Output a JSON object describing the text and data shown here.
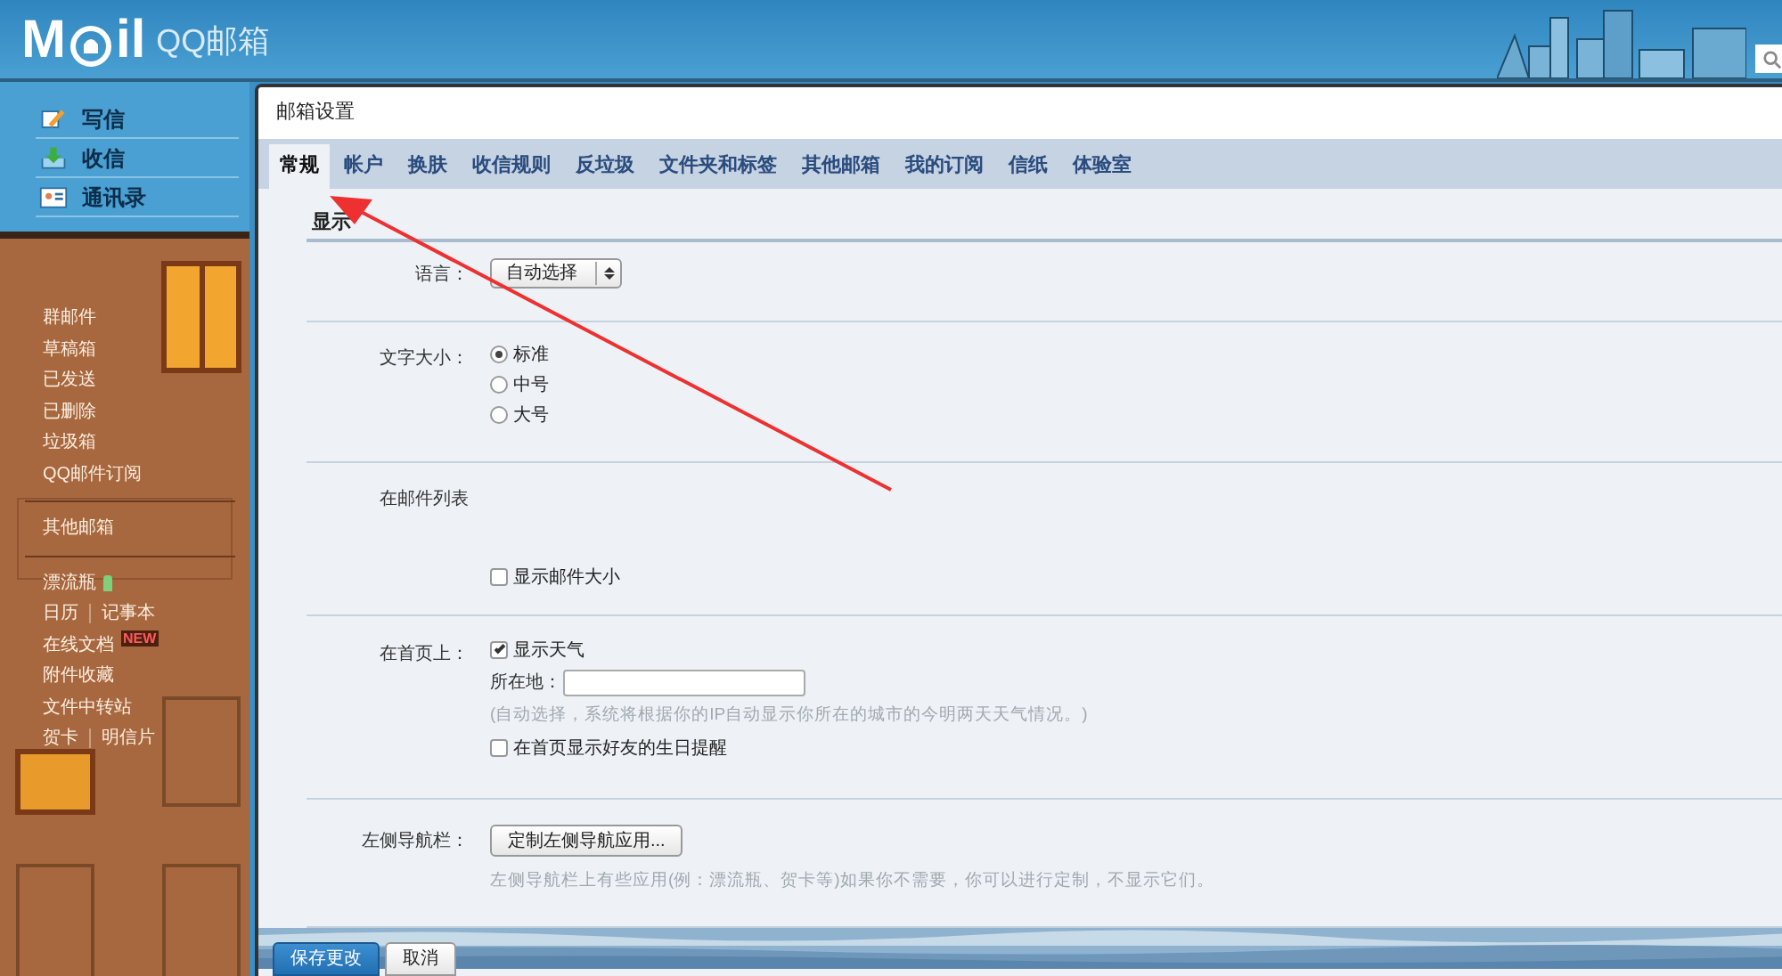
{
  "header": {
    "logo_start": "M",
    "logo_end": "il",
    "product": "QQ邮箱"
  },
  "sidebar": {
    "actions": [
      {
        "label": "写信"
      },
      {
        "label": "收信"
      },
      {
        "label": "通讯录"
      }
    ],
    "groups": [
      [
        {
          "kind": "text",
          "links": [
            "群邮件"
          ]
        },
        {
          "kind": "text",
          "links": [
            "草稿箱"
          ]
        },
        {
          "kind": "text",
          "links": [
            "已发送"
          ]
        },
        {
          "kind": "text",
          "links": [
            "已删除"
          ]
        },
        {
          "kind": "text",
          "links": [
            "垃圾箱"
          ]
        },
        {
          "kind": "text",
          "links": [
            "QQ邮件订阅"
          ]
        }
      ],
      [
        {
          "kind": "text",
          "links": [
            "其他邮箱"
          ]
        }
      ],
      [
        {
          "kind": "bottle",
          "links": [
            "漂流瓶"
          ]
        },
        {
          "kind": "text",
          "links": [
            "日历",
            "记事本"
          ]
        },
        {
          "kind": "text",
          "links": [
            "在线文档"
          ],
          "badge": "NEW"
        },
        {
          "kind": "text",
          "links": [
            "附件收藏"
          ]
        },
        {
          "kind": "text",
          "links": [
            "文件中转站"
          ]
        },
        {
          "kind": "text",
          "links": [
            "贺卡",
            "明信片"
          ]
        }
      ]
    ]
  },
  "panel": {
    "title": "邮箱设置",
    "tabs": [
      {
        "label": "常规",
        "selected": true
      },
      {
        "label": "帐户",
        "selected": false
      },
      {
        "label": "换肤",
        "selected": false
      },
      {
        "label": "收信规则",
        "selected": false
      },
      {
        "label": "反垃圾",
        "selected": false
      },
      {
        "label": "文件夹和标签",
        "selected": false
      },
      {
        "label": "其他邮箱",
        "selected": false
      },
      {
        "label": "我的订阅",
        "selected": false
      },
      {
        "label": "信纸",
        "selected": false
      },
      {
        "label": "体验室",
        "selected": false
      }
    ],
    "section": "显示",
    "rows": [
      {
        "label": "语言：",
        "controls": [
          {
            "kind": "select",
            "value": "自动选择"
          }
        ]
      },
      {
        "label": "文字大小：",
        "controls": [
          {
            "kind": "radio",
            "label": "标准",
            "selected": true
          },
          {
            "kind": "radio",
            "label": "中号",
            "selected": false
          },
          {
            "kind": "radio",
            "label": "大号",
            "selected": false
          }
        ]
      },
      {
        "label": "在邮件列表",
        "controls": [
          {
            "kind": "checkbox",
            "label": "显示邮件大小",
            "checked": false
          }
        ]
      },
      {
        "label": "在首页上：",
        "controls": [
          {
            "kind": "checkbox",
            "label": "显示天气",
            "checked": true
          },
          {
            "kind": "field",
            "label": "所在地："
          },
          {
            "kind": "hint",
            "text": "(自动选择，系统将根据你的IP自动显示你所在的城市的今明两天天气情况。)"
          },
          {
            "kind": "checkbox",
            "label": "在首页显示好友的生日提醒",
            "checked": false
          }
        ]
      },
      {
        "label": "左侧导航栏：",
        "controls": [
          {
            "kind": "button",
            "label": "定制左侧导航应用..."
          },
          {
            "kind": "hint",
            "text": "左侧导航栏上有些应用(例：漂流瓶、贺卡等)如果你不需要，你可以进行定制，不显示它们。"
          }
        ]
      }
    ],
    "footer_buttons": [
      {
        "label": "保存更改",
        "kind": "primary"
      },
      {
        "label": "取消",
        "kind": "secondary"
      }
    ]
  }
}
